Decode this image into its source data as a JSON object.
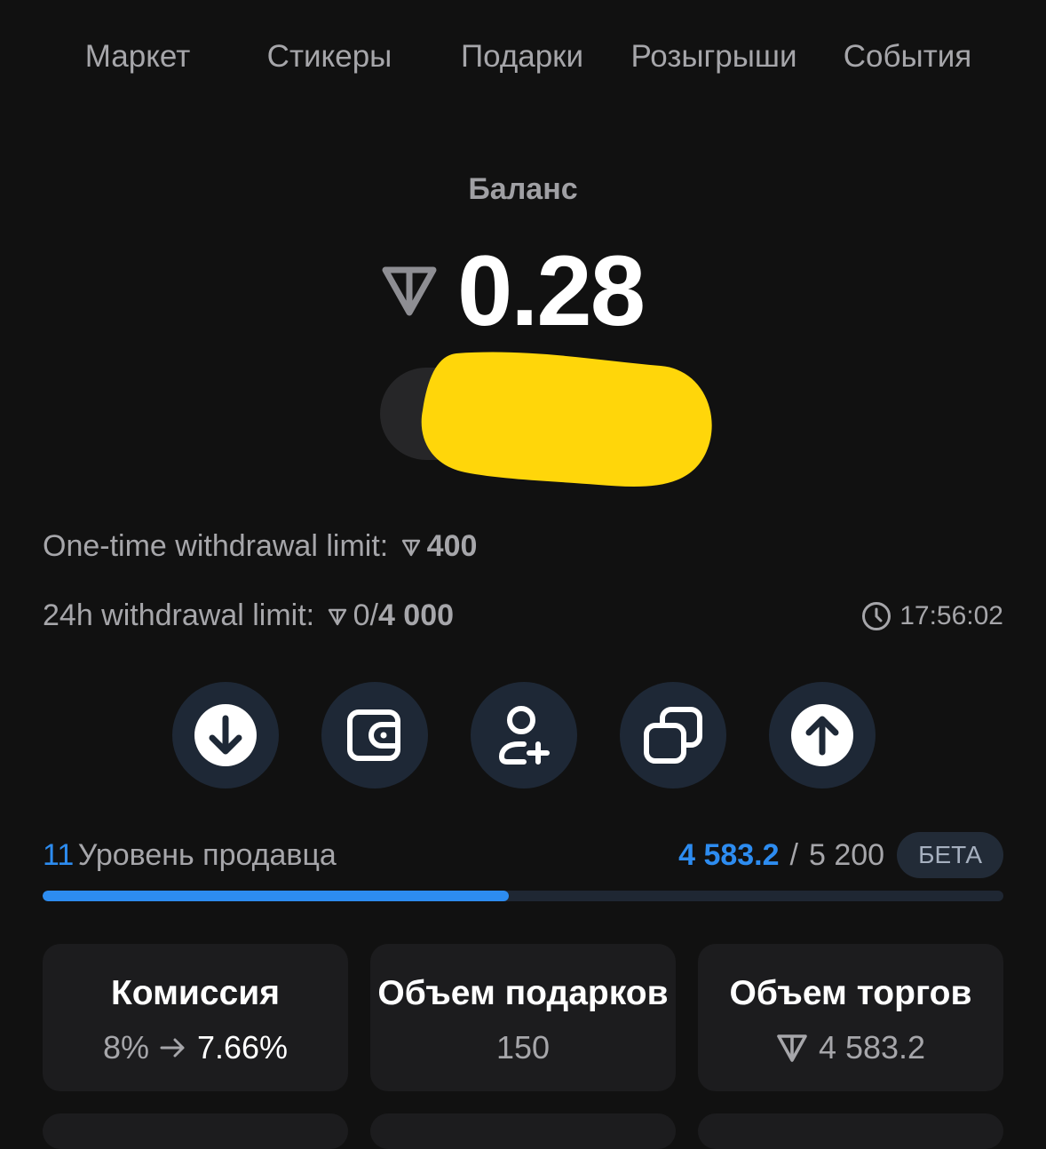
{
  "tabs": [
    "Маркет",
    "Стикеры",
    "Подарки",
    "Розыгрыши",
    "События"
  ],
  "balance": {
    "label": "Баланс",
    "amount": "0.28"
  },
  "limits": {
    "one_time_label": "One-time withdrawal limit:",
    "one_time_value": "400",
    "daily_label": "24h withdrawal limit:",
    "daily_used": "0/",
    "daily_max": "4 000",
    "timer": "17:56:02"
  },
  "actions": [
    {
      "icon": "arrow-down-circle-icon"
    },
    {
      "icon": "wallet-icon"
    },
    {
      "icon": "add-user-icon"
    },
    {
      "icon": "copy-icon"
    },
    {
      "icon": "arrow-up-circle-icon"
    }
  ],
  "level": {
    "number": "11",
    "label": "Уровень продавца",
    "current": "4 583.2",
    "separator": "/",
    "max": "5 200",
    "badge": "БЕТА",
    "progress": 0.485
  },
  "stats": [
    {
      "title": "Комиссия",
      "from": "8%",
      "to": "7.66%"
    },
    {
      "title": "Объем подарков",
      "value": "150"
    },
    {
      "title": "Объем торгов",
      "value": "4 583.2"
    }
  ],
  "colors": {
    "accent": "#2d8cf0",
    "background": "#111111",
    "card": "#1c1c1e",
    "redaction": "#ffd60a"
  }
}
